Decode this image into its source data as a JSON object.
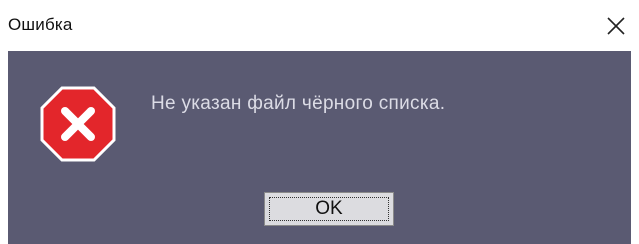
{
  "window": {
    "title": "Ошибка",
    "close_icon": "close-icon"
  },
  "dialog": {
    "icon": "error-stop-icon",
    "message": "Не указан файл чёрного списка.",
    "ok_label": "OK"
  },
  "colors": {
    "body_background": "#5a5a72",
    "message_text": "#dcdce6",
    "icon_red": "#e3262b",
    "button_face": "#dcdce0"
  }
}
